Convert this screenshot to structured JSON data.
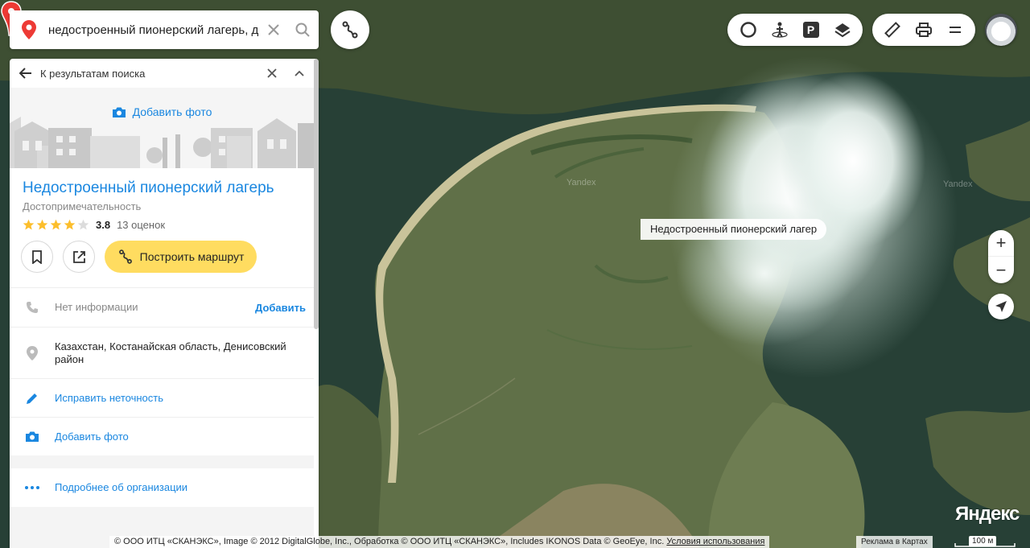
{
  "search": {
    "value": "недостроенный пионерский лагерь, ден",
    "pin_icon": "location-pin-icon",
    "clear_icon": "close-icon",
    "search_icon": "search-icon"
  },
  "route_fab_icon": "route-icon",
  "controls": {
    "group1": [
      "traffic-icon",
      "panorama-icon",
      "parking-icon",
      "layers-icon"
    ],
    "group2": [
      "ruler-icon",
      "print-icon",
      "menu-icon"
    ],
    "parking_letter": "P"
  },
  "zoom": {
    "plus": "+",
    "minus": "−"
  },
  "map": {
    "watermark": "Yandex",
    "pin_label": "Недостроенный пионерский лагер"
  },
  "panel": {
    "back_label": "К результатам поиска",
    "add_photo": "Добавить фото",
    "title": "Недостроенный пионерский лагерь",
    "category": "Достопримечательность",
    "rating": {
      "score": "3.8",
      "stars_filled": 4,
      "stars_total": 5,
      "count_label": "13 оценок"
    },
    "route_button": "Построить маршрут",
    "phone": {
      "text": "Нет информации",
      "action": "Добавить"
    },
    "address": "Казахстан, Костанайская область, Денисовский район",
    "fix_label": "Исправить неточность",
    "add_photo_row": "Добавить фото",
    "more_label": "Подробнее об организации"
  },
  "footer": {
    "copyright": "© ООО ИТЦ «СКАНЭКС», Image © 2012 DigitalGlobe, Inc., Обработка © ООО ИТЦ «СКАНЭКС», Includes IKONOS Data © GeoEye, Inc.",
    "terms": "Условия использования",
    "ads": "Реклама в Картах",
    "logo": "Яндекс",
    "scale": "100 м"
  },
  "colors": {
    "accent": "#1a87e0",
    "route_button": "#ffdc60",
    "pin": "#ed3a35",
    "star": "#fcbe2c"
  }
}
